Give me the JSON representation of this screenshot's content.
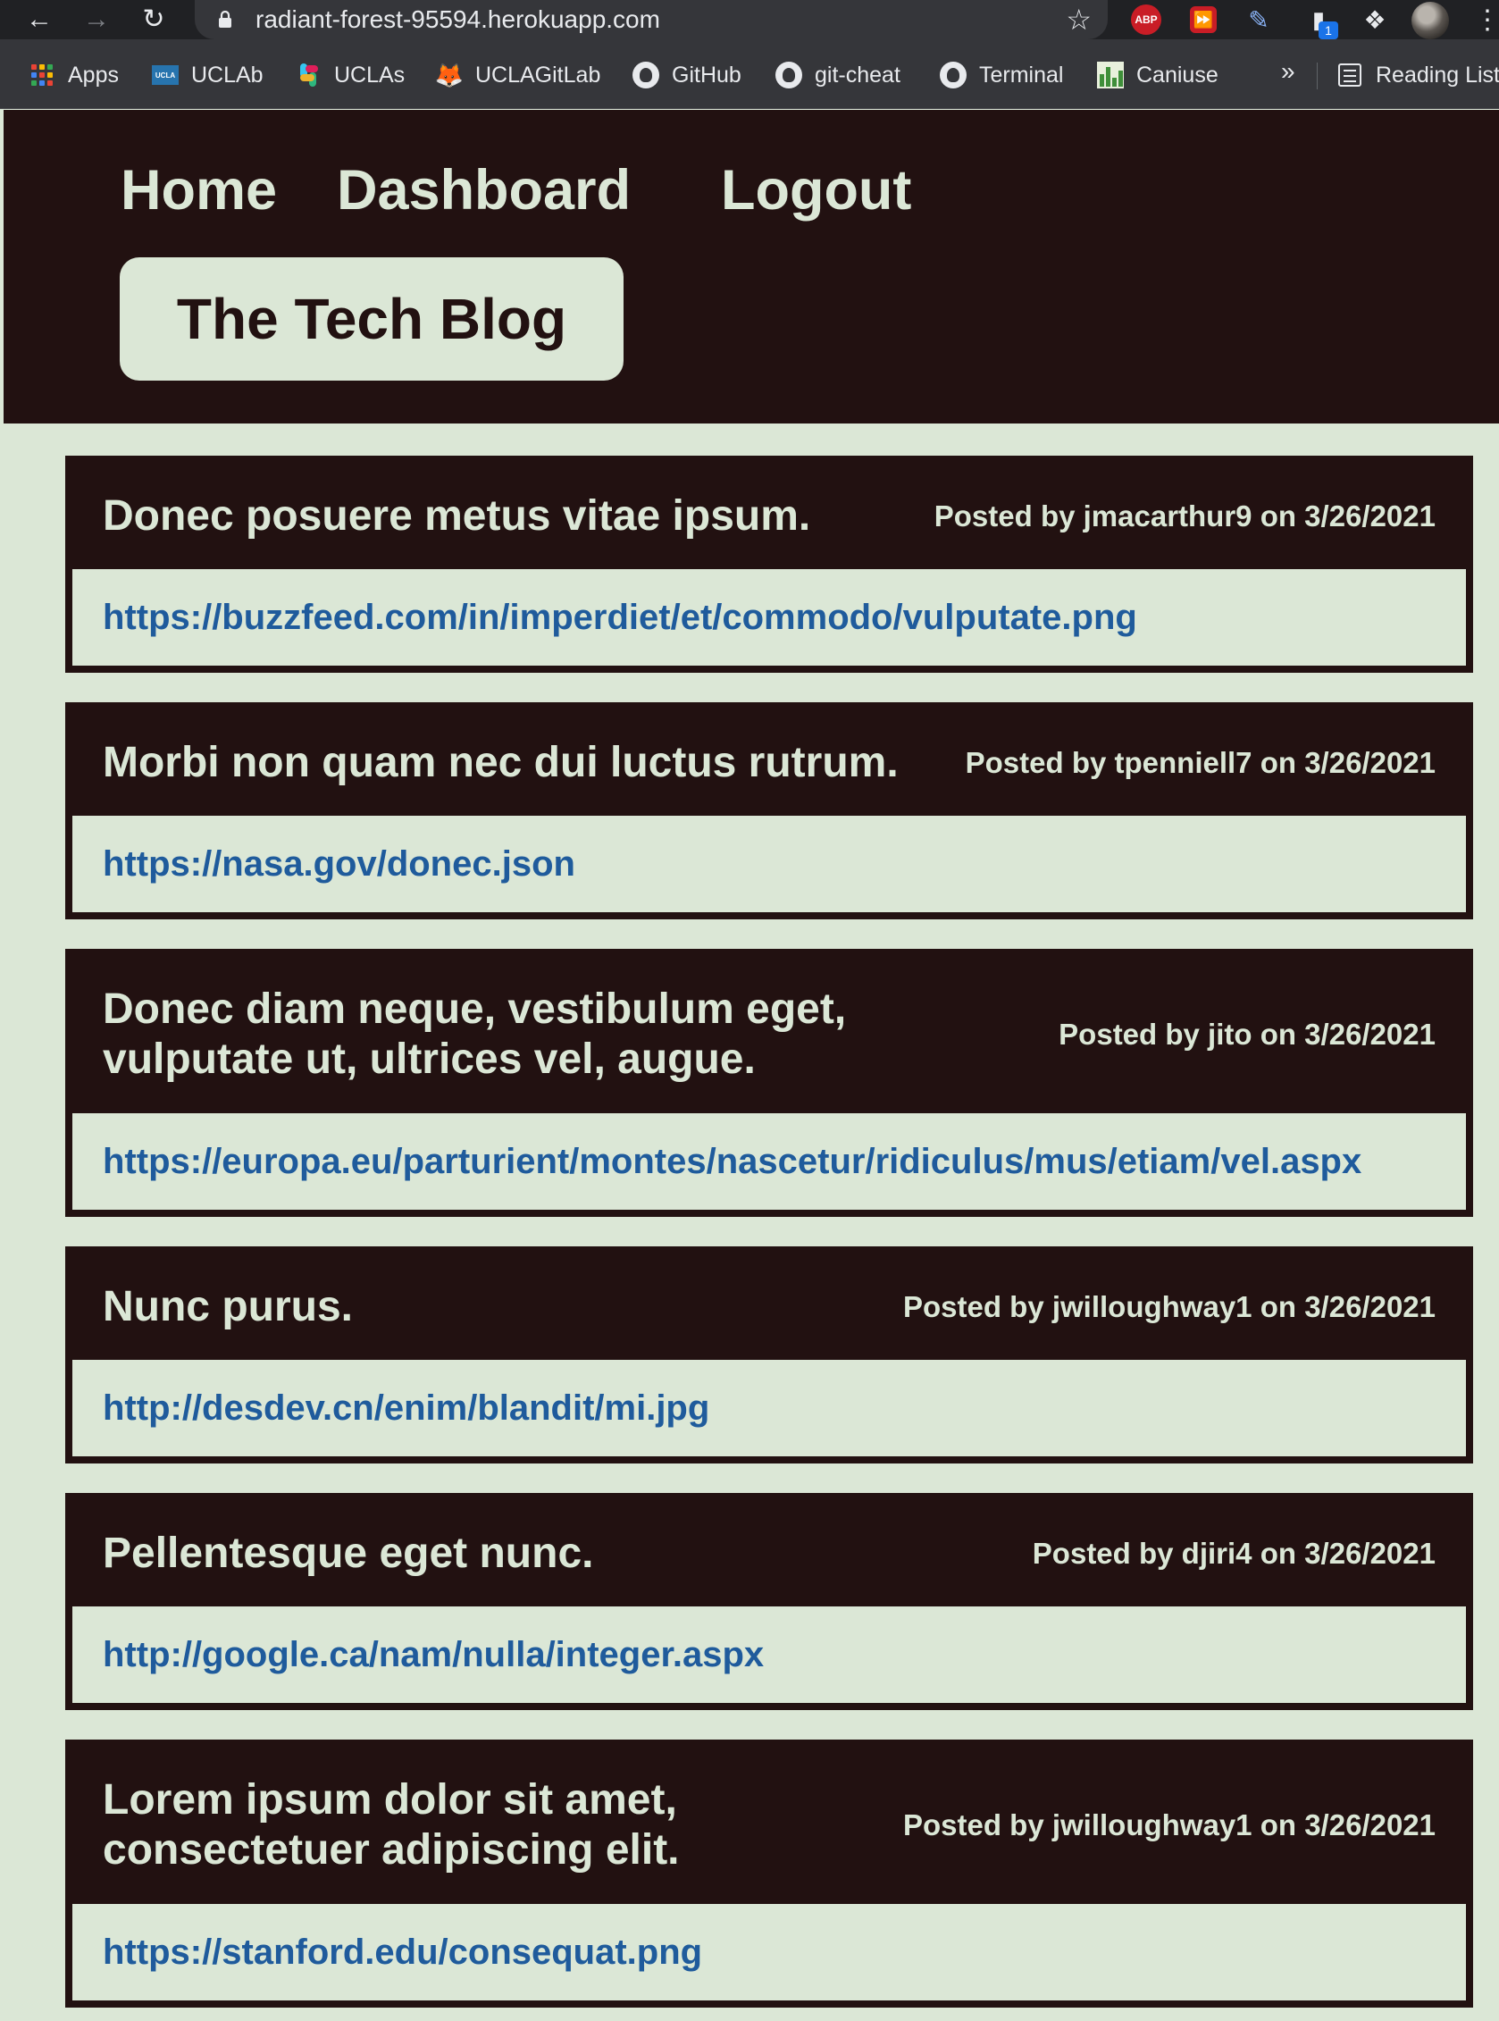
{
  "browser": {
    "url": "radiant-forest-95594.herokuapp.com",
    "extension_badge": "1",
    "abp_label": "ABP",
    "bookmarks": [
      {
        "label": "Apps",
        "icon": "apps-grid-icon"
      },
      {
        "label": "UCLAb",
        "icon": "ucla-icon"
      },
      {
        "label": "UCLAs",
        "icon": "slack-icon"
      },
      {
        "label": "UCLAGitLab",
        "icon": "gitlab-icon"
      },
      {
        "label": "GitHub",
        "icon": "github-icon"
      },
      {
        "label": "git-cheat",
        "icon": "github-icon"
      },
      {
        "label": "Terminal",
        "icon": "github-icon"
      },
      {
        "label": "Caniuse",
        "icon": "caniuse-icon"
      }
    ],
    "more_label": "»",
    "reading_list_label": "Reading List"
  },
  "nav": {
    "home": "Home",
    "dashboard": "Dashboard",
    "logout": "Logout"
  },
  "site_title": "The Tech Blog",
  "posts": [
    {
      "title": "Donec posuere metus vitae ipsum.",
      "meta": "Posted by jmacarthur9 on 3/26/2021",
      "link": "https://buzzfeed.com/in/imperdiet/et/commodo/vulputate.png"
    },
    {
      "title": "Morbi non quam nec dui luctus rutrum.",
      "meta": "Posted by tpenniell7 on 3/26/2021",
      "link": "https://nasa.gov/donec.json"
    },
    {
      "title": "Donec diam neque, vestibulum eget, vulputate ut, ultrices vel, augue.",
      "meta": "Posted by jito on 3/26/2021",
      "link": "https://europa.eu/parturient/montes/nascetur/ridiculus/mus/etiam/vel.aspx"
    },
    {
      "title": "Nunc purus.",
      "meta": "Posted by jwilloughway1 on 3/26/2021",
      "link": "http://desdev.cn/enim/blandit/mi.jpg"
    },
    {
      "title": "Pellentesque eget nunc.",
      "meta": "Posted by djiri4 on 3/26/2021",
      "link": "http://google.ca/nam/nulla/integer.aspx"
    },
    {
      "title": "Lorem ipsum dolor sit amet, consectetuer adipiscing elit.",
      "meta": "Posted by jwilloughway1 on 3/26/2021",
      "link": "https://stanford.edu/consequat.png"
    }
  ],
  "colors": {
    "header_bg": "#221111",
    "page_bg": "#dbe7d6",
    "link": "#1f5b9c"
  }
}
